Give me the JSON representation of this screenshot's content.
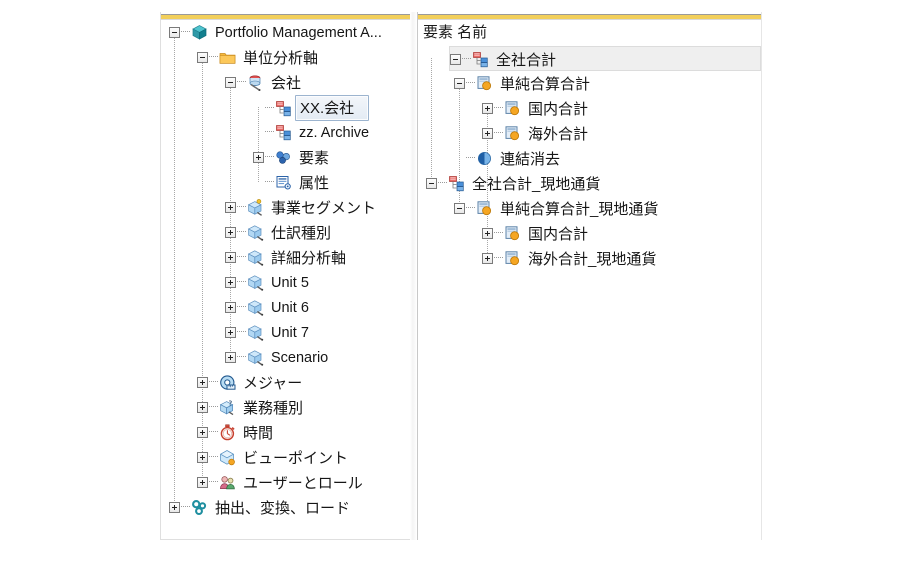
{
  "app": {
    "title": "Portfolio Management Application Tree",
    "accent_gold": "#f2cf5b",
    "selection_border": "#9cb4cf",
    "selection_fill": "#e3ebf4",
    "row_highlight": "#efefef"
  },
  "left_panel": {
    "name": "model-structure-tree",
    "nodes": [
      {
        "label": "Portfolio Management A...",
        "depth": 0,
        "expander": "minus",
        "icon": "cube-teal-icon",
        "selected": false
      },
      {
        "label": "単位分析軸",
        "depth": 1,
        "expander": "minus",
        "icon": "folder-yellow-icon",
        "selected": false
      },
      {
        "label": "会社",
        "depth": 2,
        "expander": "minus",
        "icon": "database-pen-icon",
        "selected": false
      },
      {
        "label": "XX.会社",
        "depth": 3,
        "expander": "none",
        "icon": "hierarchy-red-blue-icon",
        "selected": true
      },
      {
        "label": "zz. Archive",
        "depth": 3,
        "expander": "none",
        "icon": "hierarchy-red-blue-icon",
        "selected": false
      },
      {
        "label": "要素",
        "depth": 3,
        "expander": "plus",
        "icon": "elements-blue-icon",
        "selected": false
      },
      {
        "label": "属性",
        "depth": 3,
        "expander": "none",
        "icon": "attribute-list-icon",
        "selected": false
      },
      {
        "label": "事業セグメント",
        "depth": 2,
        "expander": "plus",
        "icon": "cube-blue-key-icon",
        "selected": false
      },
      {
        "label": "仕訳種別",
        "depth": 2,
        "expander": "plus",
        "icon": "cube-blue-icon",
        "selected": false
      },
      {
        "label": "詳細分析軸",
        "depth": 2,
        "expander": "plus",
        "icon": "cube-blue-icon",
        "selected": false
      },
      {
        "label": "Unit 5",
        "depth": 2,
        "expander": "plus",
        "icon": "cube-blue-icon",
        "selected": false
      },
      {
        "label": "Unit 6",
        "depth": 2,
        "expander": "plus",
        "icon": "cube-blue-icon",
        "selected": false
      },
      {
        "label": "Unit 7",
        "depth": 2,
        "expander": "plus",
        "icon": "cube-blue-icon",
        "selected": false
      },
      {
        "label": "Scenario",
        "depth": 2,
        "expander": "plus",
        "icon": "cube-blue-icon",
        "selected": false
      },
      {
        "label": "メジャー",
        "depth": 1,
        "expander": "plus",
        "icon": "measure-tape-icon",
        "selected": false
      },
      {
        "label": "業務種別",
        "depth": 1,
        "expander": "plus",
        "icon": "cube-question-icon",
        "selected": false
      },
      {
        "label": "時間",
        "depth": 1,
        "expander": "plus",
        "icon": "stopwatch-icon",
        "selected": false
      },
      {
        "label": "ビューポイント",
        "depth": 1,
        "expander": "plus",
        "icon": "viewpoint-cube-icon",
        "selected": false
      },
      {
        "label": "ユーザーとロール",
        "depth": 1,
        "expander": "plus",
        "icon": "users-roles-icon",
        "selected": false
      },
      {
        "label": "抽出、変換、ロード",
        "depth": 0,
        "expander": "plus",
        "icon": "etl-gears-icon",
        "selected": false
      }
    ]
  },
  "right_panel": {
    "name": "element-name-tree",
    "header": "要素 名前",
    "nodes": [
      {
        "label": "全社合計",
        "depth": 0,
        "expander": "minus",
        "icon": "hierarchy-red-blue-icon",
        "highlighted": true
      },
      {
        "label": "単純合算合計",
        "depth": 1,
        "expander": "minus",
        "icon": "element-orange-icon",
        "highlighted": false
      },
      {
        "label": "国内合計",
        "depth": 2,
        "expander": "plus",
        "icon": "element-orange-icon",
        "highlighted": false
      },
      {
        "label": "海外合計",
        "depth": 2,
        "expander": "plus",
        "icon": "element-orange-icon",
        "highlighted": false
      },
      {
        "label": "連結消去",
        "depth": 1,
        "expander": "none",
        "icon": "half-circle-blue-icon",
        "highlighted": false
      },
      {
        "label": "全社合計_現地通貨",
        "depth": 0,
        "expander": "minus",
        "icon": "hierarchy-red-blue-icon",
        "highlighted": false
      },
      {
        "label": "単純合算合計_現地通貨",
        "depth": 1,
        "expander": "minus",
        "icon": "element-orange-icon",
        "highlighted": false
      },
      {
        "label": "国内合計",
        "depth": 2,
        "expander": "plus",
        "icon": "element-orange-icon",
        "highlighted": false
      },
      {
        "label": "海外合計_現地通貨",
        "depth": 2,
        "expander": "plus",
        "icon": "element-orange-icon",
        "highlighted": false
      }
    ]
  }
}
